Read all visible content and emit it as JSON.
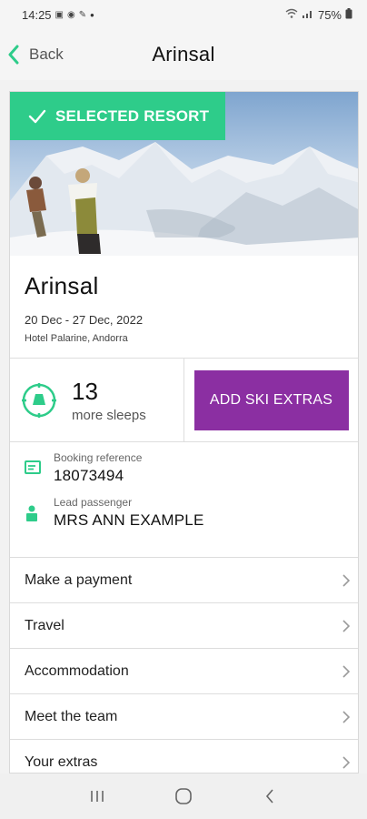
{
  "status_bar": {
    "time": "14:25",
    "dot": "•",
    "battery": "75%"
  },
  "header": {
    "back_label": "Back",
    "title": "Arinsal"
  },
  "hero": {
    "badge_label": "SELECTED RESORT"
  },
  "resort": {
    "name": "Arinsal",
    "dates": "20 Dec - 27 Dec, 2022",
    "hotel": "Hotel Palarine, Andorra"
  },
  "countdown": {
    "number": "13",
    "label": "more sleeps"
  },
  "extras_button": "ADD SKI EXTRAS",
  "booking": {
    "reference_label": "Booking reference",
    "reference_value": "18073494",
    "passenger_label": "Lead passenger",
    "passenger_value": "MRS ANN EXAMPLE"
  },
  "menu": [
    {
      "label": "Make a payment"
    },
    {
      "label": "Travel"
    },
    {
      "label": "Accommodation"
    },
    {
      "label": "Meet the team"
    },
    {
      "label": "Your extras"
    }
  ],
  "colors": {
    "accent_green": "#2ecc8a",
    "extras_purple": "#8b2fa2"
  },
  "icons": [
    "back-chevron-icon",
    "check-icon",
    "compass-icon",
    "card-icon",
    "person-icon",
    "chevron-right-icon"
  ]
}
